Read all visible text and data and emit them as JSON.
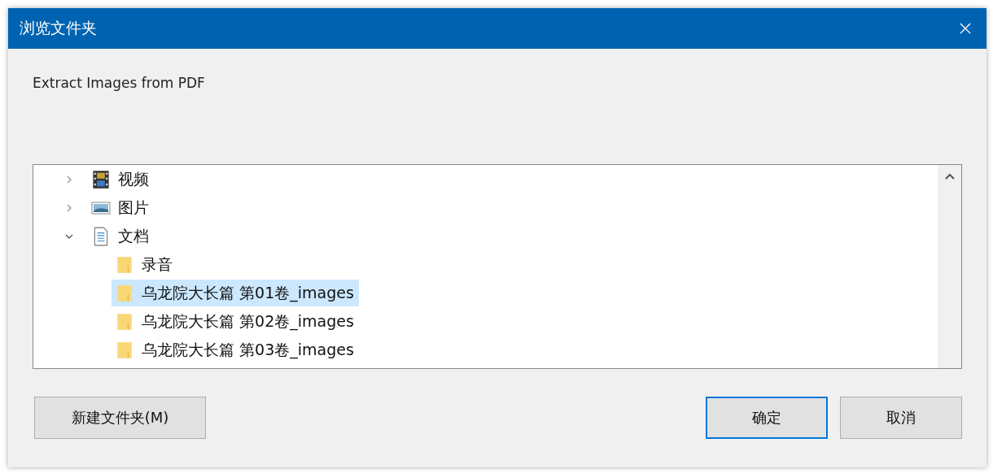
{
  "window": {
    "title": "浏览文件夹"
  },
  "description": "Extract Images from PDF",
  "tree": [
    {
      "label": "视频",
      "kind": "video",
      "expanded": false,
      "selected": false
    },
    {
      "label": "图片",
      "kind": "pictures",
      "expanded": false,
      "selected": false
    },
    {
      "label": "文档",
      "kind": "document",
      "expanded": true,
      "selected": false,
      "children": [
        {
          "label": "录音",
          "kind": "folder",
          "selected": false
        },
        {
          "label": "乌龙院大长篇 第01卷_images",
          "kind": "folder",
          "selected": true
        },
        {
          "label": "乌龙院大长篇 第02卷_images",
          "kind": "folder",
          "selected": false
        },
        {
          "label": "乌龙院大长篇 第03卷_images",
          "kind": "folder",
          "selected": false
        }
      ]
    }
  ],
  "buttons": {
    "new_folder": "新建文件夹(M)",
    "ok": "确定",
    "cancel": "取消"
  }
}
